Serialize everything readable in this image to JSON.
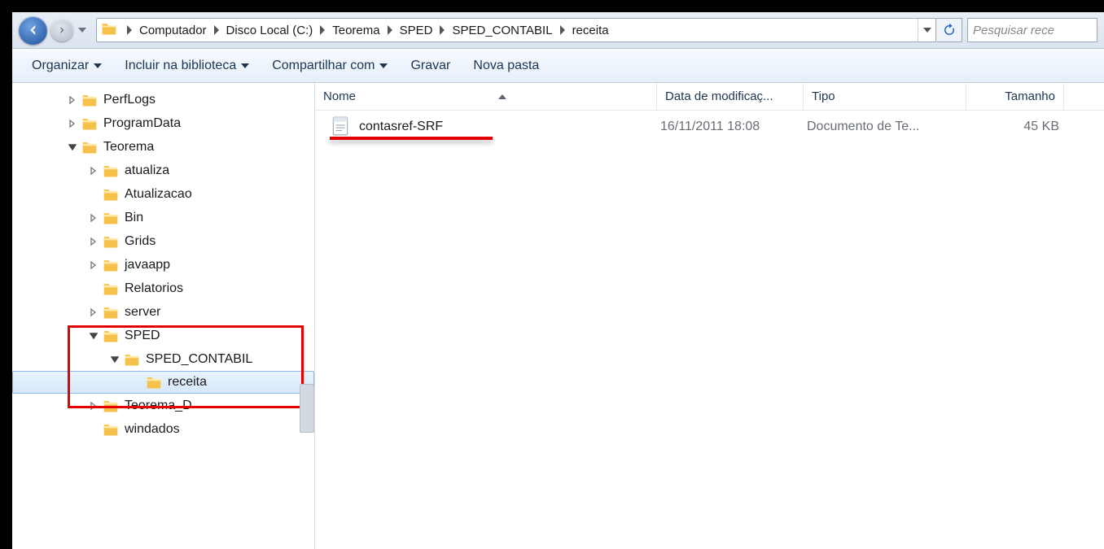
{
  "breadcrumbs": [
    "Computador",
    "Disco Local (C:)",
    "Teorema",
    "SPED",
    "SPED_CONTABIL",
    "receita"
  ],
  "search": {
    "placeholder": "Pesquisar rece"
  },
  "toolbar": {
    "organize": "Organizar",
    "include": "Incluir na biblioteca",
    "share": "Compartilhar com",
    "burn": "Gravar",
    "newfolder": "Nova pasta"
  },
  "columns": {
    "name": "Nome",
    "date": "Data de modificaç...",
    "type": "Tipo",
    "size": "Tamanho"
  },
  "tree": [
    {
      "depth": 1,
      "exp": "closed",
      "label": "PerfLogs"
    },
    {
      "depth": 1,
      "exp": "closed",
      "label": "ProgramData"
    },
    {
      "depth": 1,
      "exp": "open",
      "label": "Teorema"
    },
    {
      "depth": 2,
      "exp": "closed",
      "label": "atualiza"
    },
    {
      "depth": 2,
      "exp": "none",
      "label": "Atualizacao"
    },
    {
      "depth": 2,
      "exp": "closed",
      "label": "Bin"
    },
    {
      "depth": 2,
      "exp": "closed",
      "label": "Grids"
    },
    {
      "depth": 2,
      "exp": "closed",
      "label": "javaapp"
    },
    {
      "depth": 2,
      "exp": "none",
      "label": "Relatorios"
    },
    {
      "depth": 2,
      "exp": "closed",
      "label": "server"
    },
    {
      "depth": 2,
      "exp": "open",
      "label": "SPED"
    },
    {
      "depth": 3,
      "exp": "open",
      "label": "SPED_CONTABIL"
    },
    {
      "depth": 4,
      "exp": "none",
      "label": "receita",
      "selected": true
    },
    {
      "depth": 2,
      "exp": "closed",
      "label": "Teorema_D"
    },
    {
      "depth": 2,
      "exp": "none",
      "label": "windados"
    }
  ],
  "file": {
    "name": "contasref-SRF",
    "date": "16/11/2011 18:08",
    "type": "Documento de Te...",
    "size": "45 KB"
  }
}
